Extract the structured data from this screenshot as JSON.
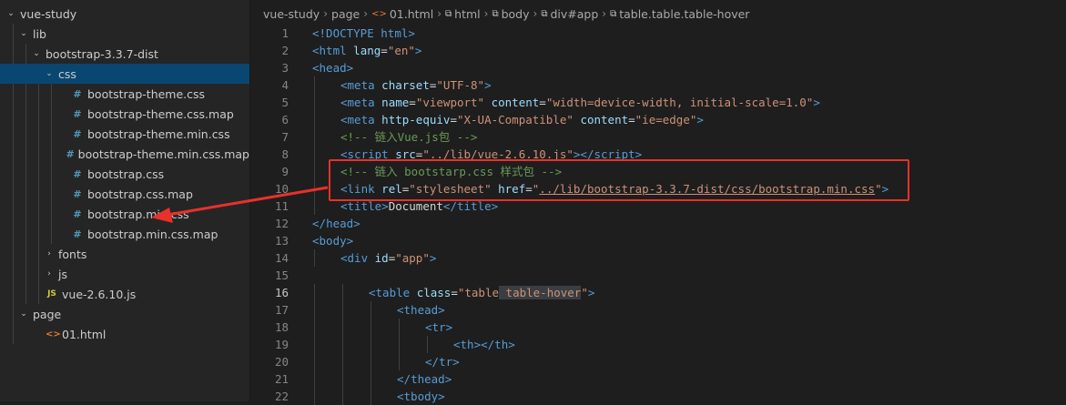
{
  "explorer": {
    "items": [
      {
        "label": "vue-study",
        "chev": "⌄",
        "icon": "",
        "kind": "folder"
      },
      {
        "label": "lib",
        "chev": "⌄",
        "icon": "",
        "kind": "folder"
      },
      {
        "label": "bootstrap-3.3.7-dist",
        "chev": "⌄",
        "icon": "",
        "kind": "folder"
      },
      {
        "label": "css",
        "chev": "⌄",
        "icon": "",
        "kind": "folder"
      },
      {
        "label": "bootstrap-theme.css",
        "chev": "",
        "icon": "#",
        "kind": "css"
      },
      {
        "label": "bootstrap-theme.css.map",
        "chev": "",
        "icon": "#",
        "kind": "css"
      },
      {
        "label": "bootstrap-theme.min.css",
        "chev": "",
        "icon": "#",
        "kind": "css"
      },
      {
        "label": "bootstrap-theme.min.css.map",
        "chev": "",
        "icon": "#",
        "kind": "css"
      },
      {
        "label": "bootstrap.css",
        "chev": "",
        "icon": "#",
        "kind": "css"
      },
      {
        "label": "bootstrap.css.map",
        "chev": "",
        "icon": "#",
        "kind": "css"
      },
      {
        "label": "bootstrap.min.css",
        "chev": "",
        "icon": "#",
        "kind": "css"
      },
      {
        "label": "bootstrap.min.css.map",
        "chev": "",
        "icon": "#",
        "kind": "css"
      },
      {
        "label": "fonts",
        "chev": "›",
        "icon": "",
        "kind": "folder"
      },
      {
        "label": "js",
        "chev": "›",
        "icon": "",
        "kind": "folder"
      },
      {
        "label": "vue-2.6.10.js",
        "chev": "",
        "icon": "JS",
        "kind": "js"
      },
      {
        "label": "page",
        "chev": "⌄",
        "icon": "",
        "kind": "folder"
      },
      {
        "label": "01.html",
        "chev": "",
        "icon": "<>",
        "kind": "html"
      }
    ]
  },
  "breadcrumb": {
    "items": [
      "vue-study",
      "page",
      "01.html",
      "html",
      "body",
      "div#app",
      "table.table.table-hover"
    ],
    "sep": "›",
    "file_icon": "<>",
    "elem_icon": "⧉"
  },
  "editor": {
    "line_numbers": [
      "1",
      "2",
      "3",
      "4",
      "5",
      "6",
      "7",
      "8",
      "9",
      "10",
      "11",
      "12",
      "13",
      "14",
      "15",
      "16",
      "17",
      "18",
      "19",
      "20",
      "21",
      "22"
    ],
    "lines": [
      [
        [
          "<!DOCTYPE ",
          "t"
        ],
        [
          "html",
          "t"
        ],
        [
          ">",
          "t"
        ]
      ],
      [
        [
          "<",
          "p"
        ],
        [
          "html ",
          "t"
        ],
        [
          "lang",
          "a"
        ],
        [
          "=",
          "d"
        ],
        [
          "\"en\"",
          "s"
        ],
        [
          ">",
          "p"
        ]
      ],
      [
        [
          "<",
          "p"
        ],
        [
          "head",
          "t"
        ],
        [
          ">",
          "p"
        ]
      ],
      [
        [
          "<",
          "p"
        ],
        [
          "meta ",
          "t"
        ],
        [
          "charset",
          "a"
        ],
        [
          "=",
          "d"
        ],
        [
          "\"UTF-8\"",
          "s"
        ],
        [
          ">",
          "p"
        ]
      ],
      [
        [
          "<",
          "p"
        ],
        [
          "meta ",
          "t"
        ],
        [
          "name",
          "a"
        ],
        [
          "=",
          "d"
        ],
        [
          "\"viewport\" ",
          "s"
        ],
        [
          "content",
          "a"
        ],
        [
          "=",
          "d"
        ],
        [
          "\"width=device-width, initial-scale=1.0\"",
          "s"
        ],
        [
          ">",
          "p"
        ]
      ],
      [
        [
          "<",
          "p"
        ],
        [
          "meta ",
          "t"
        ],
        [
          "http-equiv",
          "a"
        ],
        [
          "=",
          "d"
        ],
        [
          "\"X-UA-Compatible\" ",
          "s"
        ],
        [
          "content",
          "a"
        ],
        [
          "=",
          "d"
        ],
        [
          "\"ie=edge\"",
          "s"
        ],
        [
          ">",
          "p"
        ]
      ],
      [
        [
          "<!-- 链入Vue.js包 -->",
          "c"
        ]
      ],
      [
        [
          "<",
          "p"
        ],
        [
          "script ",
          "t"
        ],
        [
          "src",
          "a"
        ],
        [
          "=",
          "d"
        ],
        [
          "\"",
          "s"
        ],
        [
          "../lib/vue-2.6.10.js",
          "su"
        ],
        [
          "\"",
          "s"
        ],
        [
          "></",
          "p"
        ],
        [
          "script",
          "t"
        ],
        [
          ">",
          "p"
        ]
      ],
      [
        [
          "<!-- 链入 bootstarp.css 样式包 -->",
          "c"
        ]
      ],
      [
        [
          "<",
          "p"
        ],
        [
          "link ",
          "t"
        ],
        [
          "rel",
          "a"
        ],
        [
          "=",
          "d"
        ],
        [
          "\"stylesheet\" ",
          "s"
        ],
        [
          "href",
          "a"
        ],
        [
          "=",
          "d"
        ],
        [
          "\"",
          "s"
        ],
        [
          "../lib/bootstrap-3.3.7-dist/css/bootstrap.min.css",
          "su"
        ],
        [
          "\"",
          "s"
        ],
        [
          ">",
          "p"
        ]
      ],
      [
        [
          "<",
          "p"
        ],
        [
          "title",
          "t"
        ],
        [
          ">",
          "p"
        ],
        [
          "Document",
          "d"
        ],
        [
          "</",
          "p"
        ],
        [
          "title",
          "t"
        ],
        [
          ">",
          "p"
        ]
      ],
      [
        [
          "</",
          "p"
        ],
        [
          "head",
          "t"
        ],
        [
          ">",
          "p"
        ]
      ],
      [
        [
          "<",
          "p"
        ],
        [
          "body",
          "t"
        ],
        [
          ">",
          "p"
        ]
      ],
      [
        [
          "<",
          "p"
        ],
        [
          "div ",
          "t"
        ],
        [
          "id",
          "a"
        ],
        [
          "=",
          "d"
        ],
        [
          "\"app\"",
          "s"
        ],
        [
          ">",
          "p"
        ]
      ],
      [],
      [
        [
          "<",
          "p"
        ],
        [
          "table ",
          "t"
        ],
        [
          "class",
          "a"
        ],
        [
          "=",
          "d"
        ],
        [
          "\"table",
          "s"
        ],
        [
          " table-hover",
          "shl"
        ],
        [
          "\"",
          "s"
        ],
        [
          ">",
          "p"
        ]
      ],
      [
        [
          "<",
          "p"
        ],
        [
          "thead",
          "t"
        ],
        [
          ">",
          "p"
        ]
      ],
      [
        [
          "<",
          "p"
        ],
        [
          "tr",
          "t"
        ],
        [
          ">",
          "p"
        ]
      ],
      [
        [
          "<",
          "p"
        ],
        [
          "th",
          "t"
        ],
        [
          "></",
          "p"
        ],
        [
          "th",
          "t"
        ],
        [
          ">",
          "p"
        ]
      ],
      [
        [
          "</",
          "p"
        ],
        [
          "tr",
          "t"
        ],
        [
          ">",
          "p"
        ]
      ],
      [
        [
          "</",
          "p"
        ],
        [
          "thead",
          "t"
        ],
        [
          ">",
          "p"
        ]
      ],
      [
        [
          "<",
          "p"
        ],
        [
          "tbody",
          "t"
        ],
        [
          ">",
          "p"
        ]
      ]
    ]
  },
  "colors": {
    "annotation_red": "#e8312a",
    "selected_row": "#094771",
    "sidebar_bg": "#252526",
    "editor_bg": "#1e1e1e"
  }
}
